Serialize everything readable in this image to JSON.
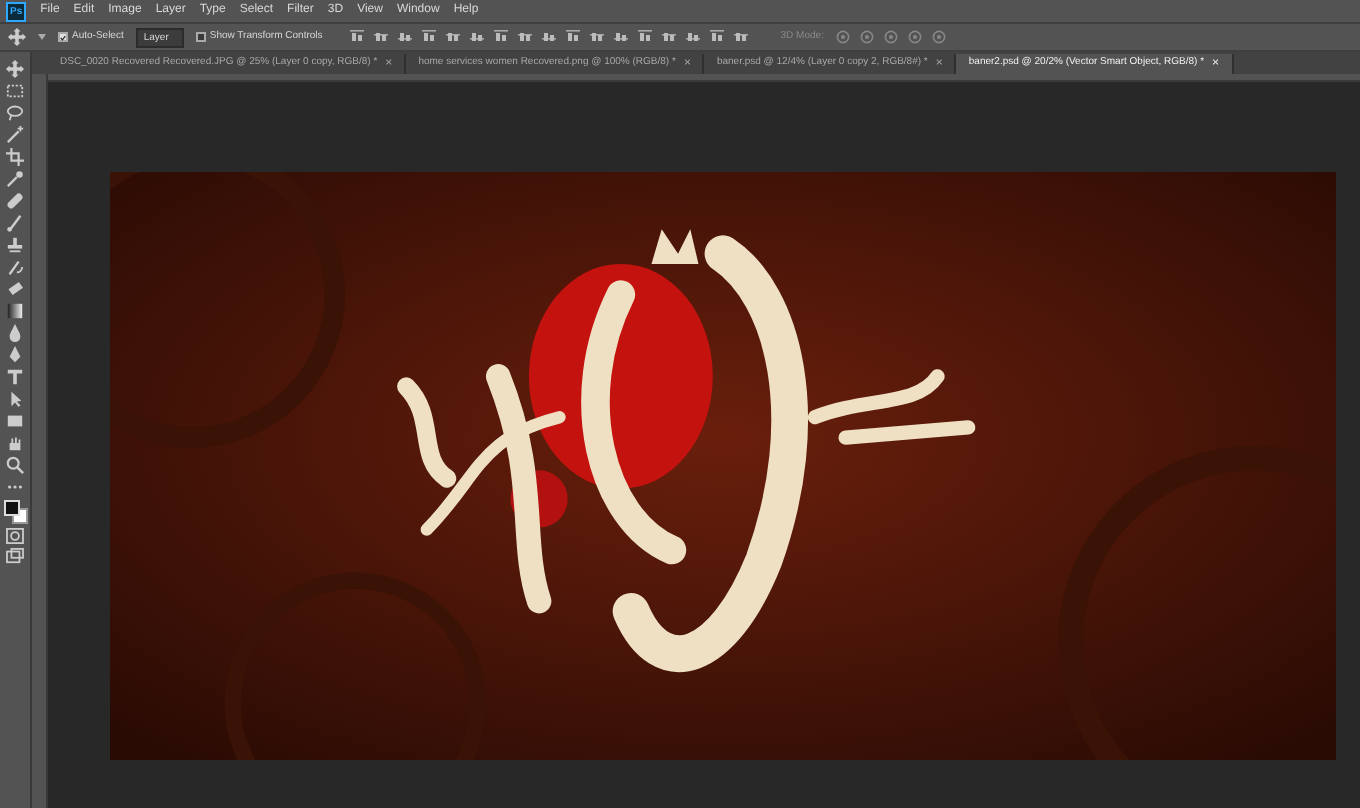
{
  "app": {
    "logo": "Ps"
  },
  "menu": [
    "File",
    "Edit",
    "Image",
    "Layer",
    "Type",
    "Select",
    "Filter",
    "3D",
    "View",
    "Window",
    "Help"
  ],
  "options_bar": {
    "auto_select": {
      "label": "Auto-Select",
      "checked": true
    },
    "target": "Layer",
    "transform_controls": {
      "label": "Show Transform Controls",
      "checked": false
    },
    "mode_label": "3D Mode:"
  },
  "tabs": [
    {
      "label": "DSC_0020 Recovered Recovered.JPG @ 25% (Layer 0 copy, RGB/8) *",
      "selected": false
    },
    {
      "label": "home services women Recovered.png @ 100% (RGB/8) *",
      "selected": false
    },
    {
      "label": "baner.psd @ 12/4% (Layer 0 copy 2, RGB/8#) *",
      "selected": false
    },
    {
      "label": "baner2.psd @ 20/2% (Vector Smart Object, RGB/8) *",
      "selected": true
    }
  ],
  "close_glyph": "×"
}
